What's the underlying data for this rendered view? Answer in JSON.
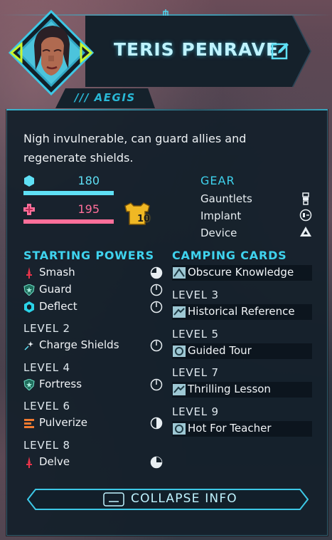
{
  "hero": {
    "name": "TERIS PENRAVE",
    "class_label": "/// AEGIS",
    "description": "Nigh invulnerable, can guard allies and regenerate shields."
  },
  "stats": {
    "shield": {
      "icon": "shield-hex-icon",
      "value": "180",
      "color": "#5fe0f5"
    },
    "health": {
      "icon": "health-cross-icon",
      "value": "195",
      "color": "#ff6f9a"
    },
    "armor_badge": {
      "icon": "armor-vest-icon",
      "value": "10",
      "color": "#f0b824"
    }
  },
  "gear": {
    "heading": "GEAR",
    "items": [
      {
        "label": "Gauntlets",
        "icon": "gauntlet-icon"
      },
      {
        "label": "Implant",
        "icon": "implant-chip-icon"
      },
      {
        "label": "Device",
        "icon": "device-drone-icon"
      }
    ]
  },
  "powers": {
    "heading": "STARTING POWERS",
    "starting": [
      {
        "name": "Smash",
        "icon": "dagger-icon",
        "cooldown": "three-quarter-clock-icon"
      },
      {
        "name": "Guard",
        "icon": "shield-star-icon",
        "cooldown": "clock-icon"
      },
      {
        "name": "Deflect",
        "icon": "hex-shield-icon",
        "cooldown": "clock-icon"
      }
    ],
    "levels": [
      {
        "level": "LEVEL 2",
        "name": "Charge Shields",
        "icon": "spark-icon",
        "cooldown": "clock-icon"
      },
      {
        "level": "LEVEL 4",
        "name": "Fortress",
        "icon": "shield-star-icon",
        "cooldown": "clock-icon"
      },
      {
        "level": "LEVEL 6",
        "name": "Pulverize",
        "icon": "pulverize-icon",
        "cooldown": "half-clock-icon"
      },
      {
        "level": "LEVEL 8",
        "name": "Delve",
        "icon": "dagger-icon",
        "cooldown": "quarter-clock-icon"
      }
    ]
  },
  "camping": {
    "heading": "CAMPING CARDS",
    "starting": {
      "name": "Obscure Knowledge",
      "icon": "card-knowledge-icon"
    },
    "levels": [
      {
        "level": "LEVEL 3",
        "name": "Historical Reference",
        "icon": "card-lesson-icon"
      },
      {
        "level": "LEVEL 5",
        "name": "Guided Tour",
        "icon": "card-tour-icon"
      },
      {
        "level": "LEVEL 7",
        "name": "Thrilling Lesson",
        "icon": "card-lesson-icon"
      },
      {
        "level": "LEVEL 9",
        "name": "Hot For Teacher",
        "icon": "card-tour-icon"
      }
    ]
  },
  "collapse": {
    "label": "COLLAPSE INFO",
    "key_icon": "spacebar-key-icon"
  }
}
